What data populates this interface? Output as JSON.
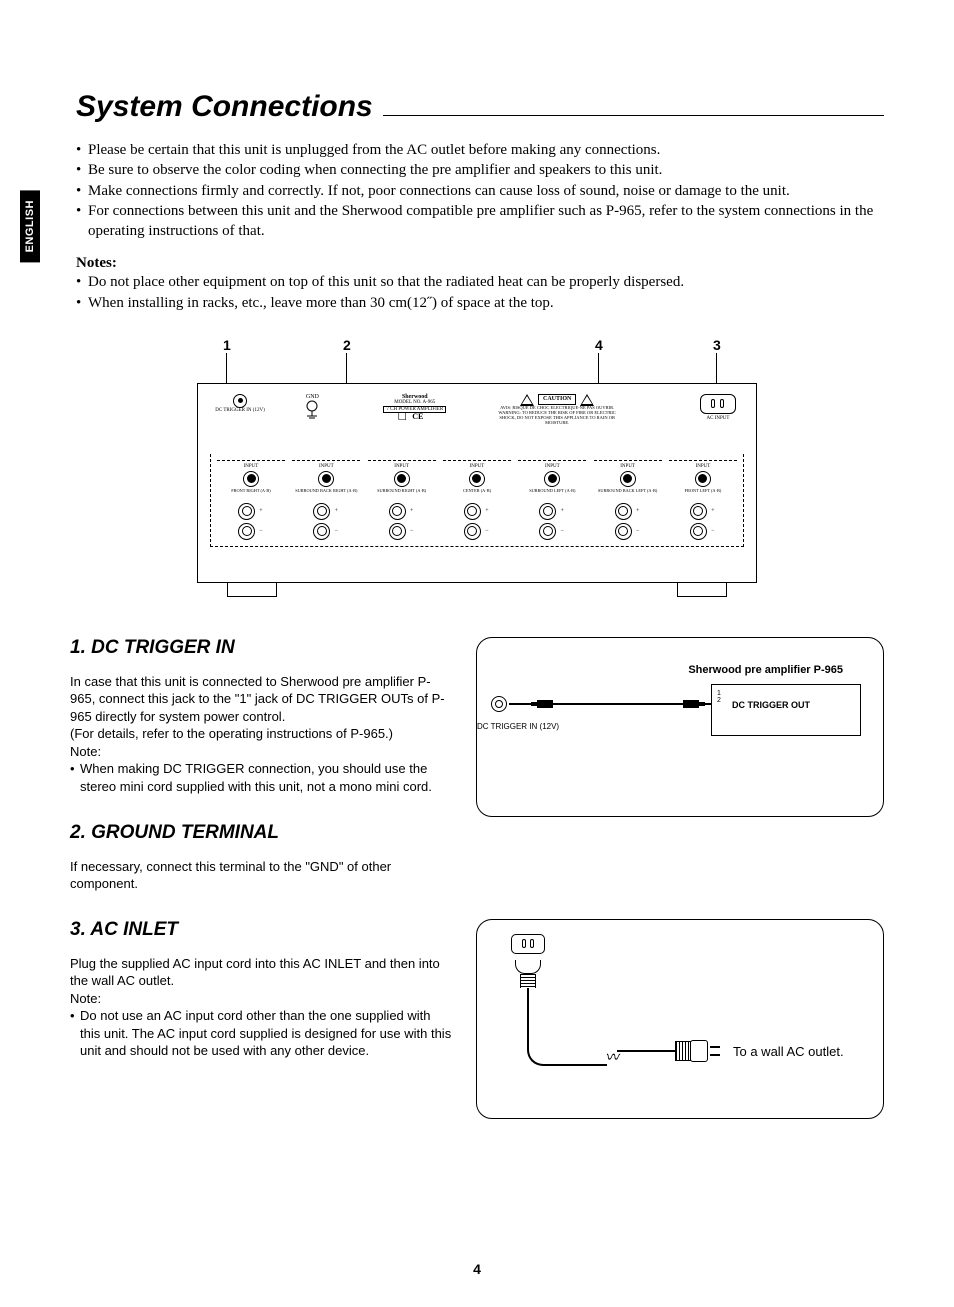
{
  "language_tab": "ENGLISH",
  "page_title": "System Connections",
  "intro_bullets": [
    "Please be certain that this unit is unplugged from the AC outlet before making any connections.",
    "Be sure to observe the color coding when connecting the pre amplifier and speakers to this unit.",
    "Make connections firmly and correctly. If not, poor connections can cause loss of sound, noise or damage to the unit.",
    "For connections between this unit and the Sherwood compatible pre amplifier such as P-965, refer to the system connections in the operating instructions of that."
  ],
  "notes_heading": "Notes:",
  "notes_bullets": [
    "Do not place other equipment on top of this unit so that the radiated heat can be properly dispersed.",
    "When installing in racks, etc., leave more than 30 cm(12˝) of space at the top."
  ],
  "callouts": {
    "c1": "1",
    "c2": "2",
    "c3": "4",
    "c4": "3"
  },
  "rear_panel": {
    "dc_in_label": "DC TRIGGER IN (12V)",
    "gnd_label": "GND",
    "brand": "Sherwood",
    "model_line": "MODEL NO. A-965",
    "amp_line": "7 CH POWER AMPLIFIER",
    "caution": "CAUTION",
    "warn_text": "AVIS: RISQUE DE CHOC ELECTRIQUE-NE PAS OUVRIR.\nWARNING: TO REDUCE THE RISK OF FIRE OR ELECTRIC SHOCK, DO NOT EXPOSE THIS APPLIANCE TO RAIN OR MOISTURE.",
    "ac_label": "AC INPUT",
    "input_lbl": "INPUT",
    "channels": [
      "FRONT RIGHT (A·B)",
      "SURROUND BACK RIGHT (A·B)",
      "SURROUND RIGHT (A·B)",
      "CENTER (A·B)",
      "SURROUND LEFT (A·B)",
      "SURROUND BACK LEFT (A·B)",
      "FRONT LEFT (A·B)"
    ]
  },
  "section1": {
    "heading": "1. DC TRIGGER IN",
    "p1": "In case that this unit is connected to Sherwood pre amplifier P-965, connect this jack to the \"1\" jack of DC TRIGGER OUTs of P-965 directly for system power control.",
    "p2": "(For details, refer to the operating instructions of P-965.)",
    "note_label": "Note:",
    "bullet": "When making DC TRIGGER connection, you should use the stereo mini cord supplied with this unit, not a mono mini cord."
  },
  "fig1": {
    "p965_label": "Sherwood pre amplifier P-965",
    "out_label": "DC TRIGGER OUT",
    "nums": "1\n2",
    "left_label": "DC TRIGGER IN (12V)"
  },
  "section2": {
    "heading": "2. GROUND TERMINAL",
    "p1": "If necessary, connect this terminal to the \"GND\" of other component."
  },
  "section3": {
    "heading": "3. AC INLET",
    "p1": "Plug the supplied AC input cord into this AC INLET and then into the wall AC outlet.",
    "note_label": "Note:",
    "bullet": "Do not use an AC input cord other than the one supplied with this unit. The AC input cord supplied is designed for use with this unit and should not be used with any other device."
  },
  "fig3": {
    "wall_label": "To a wall AC outlet."
  },
  "page_number": "4"
}
